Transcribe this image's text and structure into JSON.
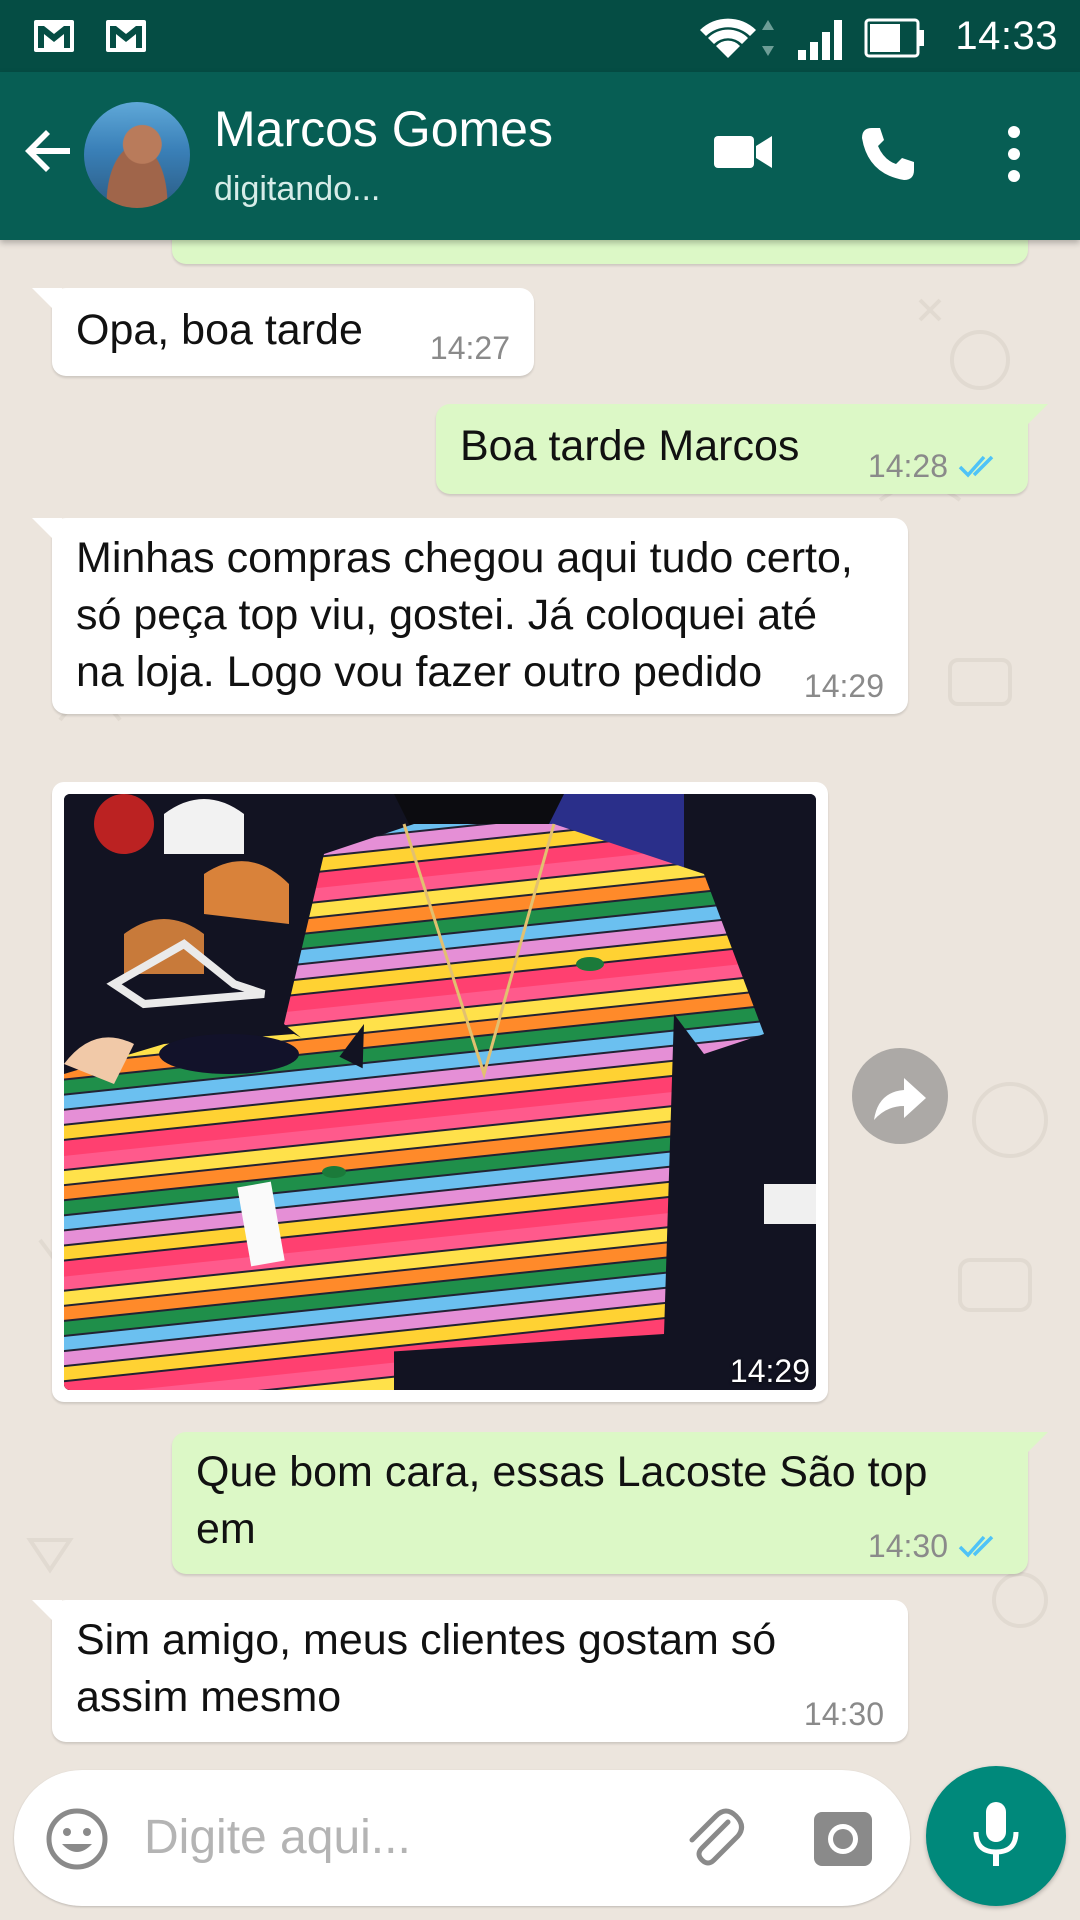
{
  "status_bar": {
    "time": "14:33",
    "icons": [
      "gmail-icon",
      "gmail-icon",
      "wifi-icon",
      "signal-icon",
      "battery-icon"
    ]
  },
  "header": {
    "contact_name": "Marcos Gomes",
    "contact_status": "digitando...",
    "icons": [
      "back-arrow-icon",
      "avatar",
      "video-call-icon",
      "phone-icon",
      "more-vert-icon"
    ]
  },
  "messages": [
    {
      "direction": "in",
      "text": "Opa, boa tarde",
      "time": "14:27"
    },
    {
      "direction": "out",
      "text": "Boa tarde Marcos",
      "time": "14:28",
      "read": true
    },
    {
      "direction": "in",
      "text": "Minhas compras chegou aqui tudo certo, só peça top viu, gostei. Já coloquei até na loja. Logo vou fazer outro pedido",
      "time": "14:29"
    },
    {
      "direction": "in",
      "type": "image",
      "time": "14:29"
    },
    {
      "direction": "out",
      "text": "Que bom cara, essas Lacoste São top em",
      "time": "14:30",
      "read": true
    },
    {
      "direction": "in",
      "text": "Sim amigo, meus clientes gostam só assim mesmo",
      "time": "14:30"
    }
  ],
  "input": {
    "placeholder": "Digite aqui..."
  },
  "colors": {
    "status_bar": "#054d44",
    "header": "#075e54",
    "outgoing_bubble": "#dcf8c6",
    "incoming_bubble": "#ffffff",
    "read_ticks": "#4fc3f7",
    "mic_button": "#00897b"
  }
}
